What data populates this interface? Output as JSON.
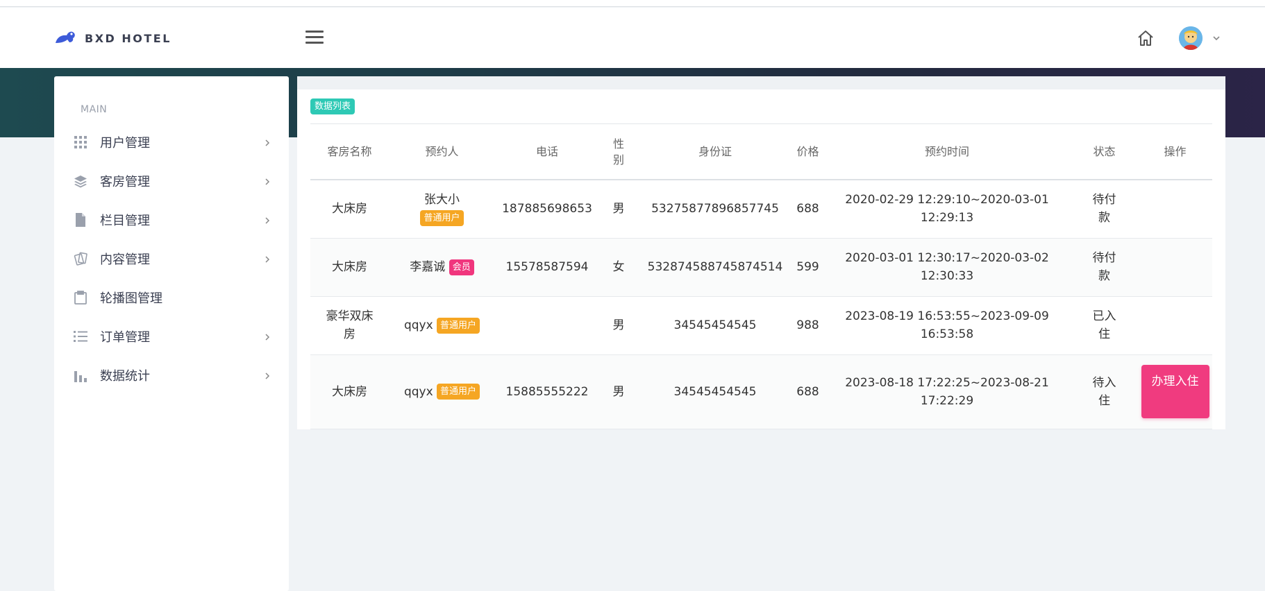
{
  "header": {
    "logo_text": "BXD HOTEL"
  },
  "sidebar": {
    "section_title": "MAIN",
    "items": [
      {
        "label": "用户管理",
        "icon": "grid-icon",
        "has_arrow": true
      },
      {
        "label": "客房管理",
        "icon": "layers-icon",
        "has_arrow": true
      },
      {
        "label": "栏目管理",
        "icon": "file-icon",
        "has_arrow": true
      },
      {
        "label": "内容管理",
        "icon": "cards-icon",
        "has_arrow": true
      },
      {
        "label": "轮播图管理",
        "icon": "clipboard-icon",
        "has_arrow": false
      },
      {
        "label": "订单管理",
        "icon": "list-icon",
        "has_arrow": true
      },
      {
        "label": "数据统计",
        "icon": "bar-chart-icon",
        "has_arrow": true
      }
    ]
  },
  "main": {
    "tag": "数据列表",
    "columns": [
      "客房名称",
      "预约人",
      "电话",
      "性别",
      "身份证",
      "价格",
      "预约时间",
      "状态",
      "操作"
    ],
    "rows": [
      {
        "room": "大床房",
        "person": "张大小",
        "person_badge": "普通用户",
        "badge_type": "user",
        "phone": "187885698653",
        "gender": "男",
        "id_card": "53275877896857745",
        "price": "688",
        "time_start": "2020-02-29 12:29:10~2020-03-01",
        "time_end": "12:29:13",
        "status": "待付款",
        "action": ""
      },
      {
        "room": "大床房",
        "person": "李嘉诚",
        "person_badge": "会员",
        "badge_type": "member",
        "phone": "15578587594",
        "gender": "女",
        "id_card": "532874588745874514",
        "price": "599",
        "time_start": "2020-03-01 12:30:17~2020-03-02",
        "time_end": "12:30:33",
        "status": "待付款",
        "action": ""
      },
      {
        "room": "豪华双床房",
        "person": "qqyx",
        "person_badge": "普通用户",
        "badge_type": "user",
        "phone": "",
        "gender": "男",
        "id_card": "34545454545",
        "price": "988",
        "time_start": "2023-08-19 16:53:55~2023-09-09",
        "time_end": "16:53:58",
        "status": "已入住",
        "action": ""
      },
      {
        "room": "大床房",
        "person": "qqyx",
        "person_badge": "普通用户",
        "badge_type": "user",
        "phone": "15885555222",
        "gender": "男",
        "id_card": "34545454545",
        "price": "688",
        "time_start": "2023-08-18 17:22:25~2023-08-21",
        "time_end": "17:22:29",
        "status": "待入住",
        "action": "办理入住"
      }
    ]
  },
  "colors": {
    "accent_teal": "#2ec9b5",
    "badge_user": "#f5a623",
    "badge_member": "#f0367d",
    "action_button": "#f03b7f"
  }
}
